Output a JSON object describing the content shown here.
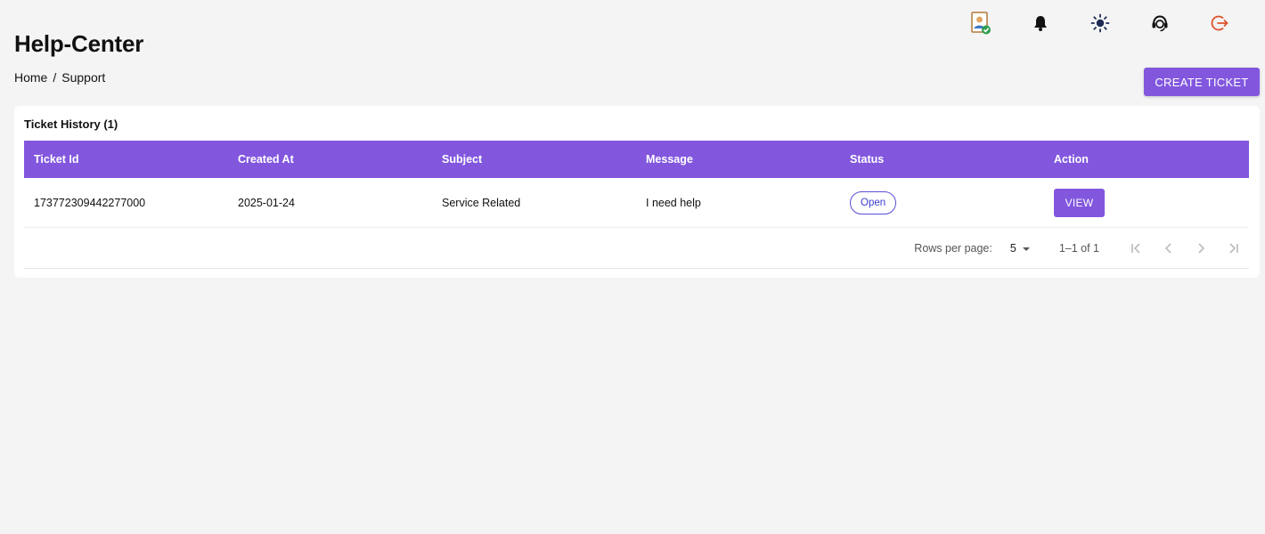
{
  "header": {
    "title": "Help-Center",
    "breadcrumb": [
      "Home",
      "Support"
    ],
    "breadcrumb_separator": "/",
    "create_button_label": "CREATE TICKET"
  },
  "topbar": {
    "icons": [
      "profile-verified-icon",
      "bell-icon",
      "sun-icon",
      "support-agent-icon",
      "logout-icon"
    ]
  },
  "ticket_history": {
    "title": "Ticket History (1)",
    "columns": [
      "Ticket Id",
      "Created At",
      "Subject",
      "Message",
      "Status",
      "Action"
    ],
    "rows": [
      {
        "ticket_id": "173772309442277000",
        "created_at": "2025-01-24",
        "subject": "Service Related",
        "message": "I need help",
        "status": "Open",
        "action_label": "VIEW"
      }
    ],
    "pagination": {
      "rows_per_page_label": "Rows per page:",
      "rows_per_page_value": "5",
      "range_text": "1–1 of 1"
    }
  },
  "colors": {
    "accent": "#8257de",
    "background": "#f4f4f4",
    "status_open": "#3b3bd0",
    "logout": "#e0512b"
  }
}
